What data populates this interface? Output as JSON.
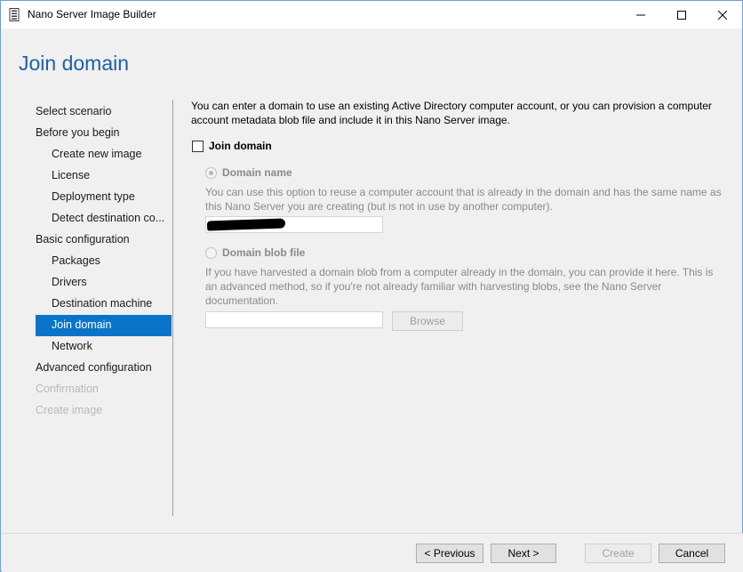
{
  "window": {
    "title": "Nano Server Image Builder",
    "controls": {
      "minimize": "minimize-icon",
      "maximize": "maximize-icon",
      "close": "close-icon"
    }
  },
  "page_title": "Join domain",
  "nav": [
    {
      "label": "Select scenario",
      "level": 0,
      "state": "normal"
    },
    {
      "label": "Before you begin",
      "level": 0,
      "state": "normal"
    },
    {
      "label": "Create new image",
      "level": 1,
      "state": "normal"
    },
    {
      "label": "License",
      "level": 1,
      "state": "normal"
    },
    {
      "label": "Deployment type",
      "level": 1,
      "state": "normal"
    },
    {
      "label": "Detect destination co...",
      "level": 1,
      "state": "normal"
    },
    {
      "label": "Basic configuration",
      "level": 0,
      "state": "normal"
    },
    {
      "label": "Packages",
      "level": 1,
      "state": "normal"
    },
    {
      "label": "Drivers",
      "level": 1,
      "state": "normal"
    },
    {
      "label": "Destination machine",
      "level": 1,
      "state": "normal"
    },
    {
      "label": "Join domain",
      "level": 1,
      "state": "active"
    },
    {
      "label": "Network",
      "level": 1,
      "state": "normal"
    },
    {
      "label": "Advanced configuration",
      "level": 0,
      "state": "normal"
    },
    {
      "label": "Confirmation",
      "level": 0,
      "state": "disabled"
    },
    {
      "label": "Create image",
      "level": 0,
      "state": "disabled"
    }
  ],
  "content": {
    "intro": "You can enter a domain to use an existing Active Directory computer account, or you can provision a computer account metadata blob file and include it in this Nano Server image.",
    "join_domain_checkbox": {
      "label": "Join domain",
      "checked": false
    },
    "domain_name": {
      "label": "Domain name",
      "selected": true,
      "description": "You can use this option to reuse a computer account that is already in the domain and has the same name as this Nano Server you are creating (but is not in use by another computer).",
      "value": ""
    },
    "domain_blob": {
      "label": "Domain blob file",
      "selected": false,
      "description": "If you have harvested a domain blob from a computer already in the domain, you can provide it here. This is an advanced method, so if you're not already familiar with harvesting blobs, see the Nano Server documentation.",
      "value": "",
      "browse_label": "Browse"
    }
  },
  "footer": {
    "previous": "< Previous",
    "next": "Next >",
    "create": "Create",
    "cancel": "Cancel"
  },
  "colors": {
    "accent": "#0a74c9",
    "title_blue": "#1e5fa8",
    "disabled_text": "#b9b9b9"
  }
}
